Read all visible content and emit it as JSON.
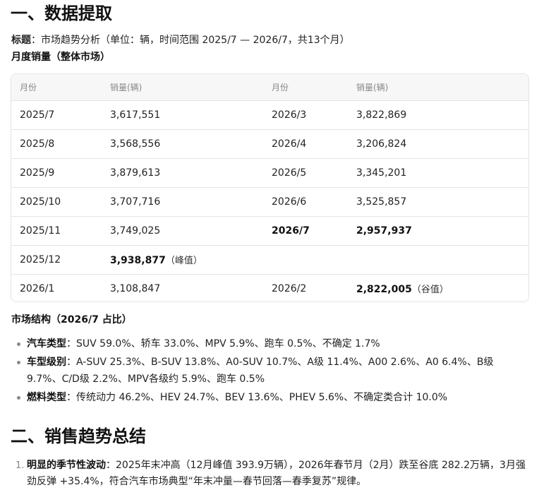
{
  "section1": {
    "title": "一、数据提取",
    "meta_label": "标题",
    "meta_text": "：市场趋势分析（单位：辆，时间范围 2025/7 — 2026/7，共13个月）",
    "monthly_heading": "月度销量（整体市场）"
  },
  "table": {
    "headers": [
      "月份",
      "销量(辆)",
      "月份",
      "销量(辆)"
    ],
    "rows": [
      {
        "m1": "2025/7",
        "v1": "3,617,551",
        "n1": "",
        "m2": "2026/3",
        "v2": "3,822,869",
        "n2": ""
      },
      {
        "m1": "2025/8",
        "v1": "3,568,556",
        "n1": "",
        "m2": "2026/4",
        "v2": "3,206,824",
        "n2": ""
      },
      {
        "m1": "2025/9",
        "v1": "3,879,613",
        "n1": "",
        "m2": "2026/5",
        "v2": "3,345,201",
        "n2": ""
      },
      {
        "m1": "2025/10",
        "v1": "3,707,716",
        "n1": "",
        "m2": "2026/6",
        "v2": "3,525,857",
        "n2": ""
      },
      {
        "m1": "2025/11",
        "v1": "3,749,025",
        "n1": "",
        "m2": "2026/7",
        "v2": "2,957,937",
        "n2": ""
      },
      {
        "m1": "2025/12",
        "v1": "3,938,877",
        "n1": "（峰值）",
        "m2": "",
        "v2": "",
        "n2": ""
      },
      {
        "m1": "2026/1",
        "v1": "3,108,847",
        "n1": "",
        "m2": "2026/2",
        "v2": "2,822,005",
        "n2": "（谷值）"
      }
    ]
  },
  "structure": {
    "heading": "市场结构（2026/7 占比）",
    "items": [
      {
        "label": "汽车类型",
        "text": "：SUV 59.0%、轿车 33.0%、MPV 5.9%、跑车 0.5%、不确定 1.7%"
      },
      {
        "label": "车型级别",
        "text": "：A-SUV 25.3%、B-SUV 13.8%、A0-SUV 10.7%、A级 11.4%、A00 2.6%、A0 6.4%、B级 9.7%、C/D级 2.2%、MPV各级约 5.9%、跑车 0.5%"
      },
      {
        "label": "燃料类型",
        "text": "：传统动力 46.2%、HEV 24.7%、BEV 13.6%、PHEV 5.6%、不确定类合计 10.0%"
      }
    ]
  },
  "section2": {
    "title": "二、销售趋势总结",
    "items": [
      {
        "num": "1.",
        "label": "明显的季节性波动",
        "text": "：2025年末冲高（12月峰值 393.9万辆），2026年春节月（2月）跌至谷底 282.2万辆，3月强劲反弹 +35.4%，符合汽车市场典型“年末冲量—春节回落—春季复苏”规律。"
      }
    ]
  }
}
